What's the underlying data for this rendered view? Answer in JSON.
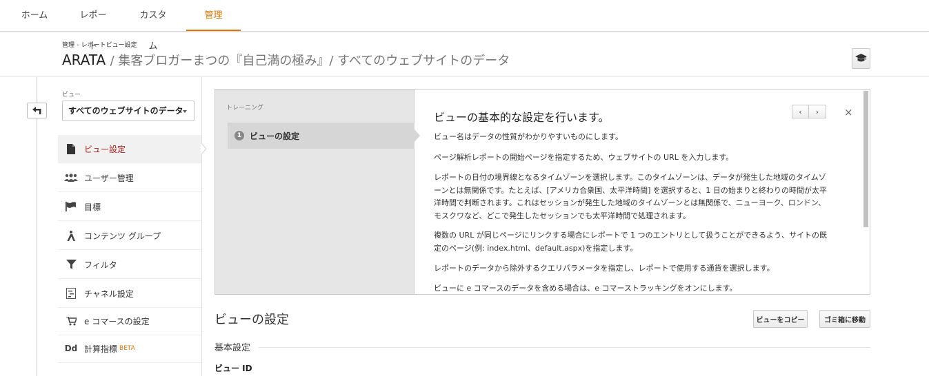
{
  "topnav": {
    "tabs": [
      {
        "label": "ホーム"
      },
      {
        "label": "レポート"
      },
      {
        "label": "カスタム"
      },
      {
        "label": "管理"
      }
    ],
    "active_color": "#e37400"
  },
  "header": {
    "breadcrumb": [
      "管理",
      "レポートビュー設定"
    ],
    "account": "ARATA",
    "title_rest": "/ 集客ブロガーまつの『自己満の極み』/ すべてのウェブサイトのデータ",
    "cap_icon": "graduation-cap-icon"
  },
  "sidebar": {
    "view_label": "ビュー",
    "view_selected": "すべてのウェブサイトのデータ",
    "items": [
      {
        "label": "ビュー設定",
        "icon": "document-icon",
        "active": true
      },
      {
        "label": "ユーザー管理",
        "icon": "users-icon"
      },
      {
        "label": "目標",
        "icon": "flag-icon"
      },
      {
        "label": "コンテンツ グループ",
        "icon": "person-walk-icon"
      },
      {
        "label": "フィルタ",
        "icon": "filter-icon"
      },
      {
        "label": "チャネル設定",
        "icon": "channel-settings-icon"
      },
      {
        "label": "e コマースの設定",
        "icon": "cart-icon"
      },
      {
        "label": "計算指標",
        "icon": "dd-icon",
        "badge": "BETA"
      }
    ],
    "active_color": "#b0201a"
  },
  "training": {
    "label": "トレーニング",
    "step_number": "1",
    "step_label": "ビューの設定",
    "title": "ビューの基本的な設定を行います。",
    "paragraphs": [
      "ビュー名はデータの性質がわかりやすいものにします。",
      "ページ解析レポートの開始ページを指定するため、ウェブサイトの URL を入力します。",
      "レポートの日付の境界線となるタイムゾーンを選択します。このタイムゾーンは、データが発生した地域のタイムゾーンとは無関係です。たとえば、[アメリカ合衆国、太平洋時間] を選択すると、1 日の始まりと終わりの時間が太平洋時間で判断されます。これはセッションが発生した地域のタイムゾーンとは無関係で、ニューヨーク、ロンドン、モスクワなど、どこで発生したセッションでも太平洋時間で処理されます。",
      "複数の URL が同じページにリンクする場合にレポートで 1 つのエントリとして扱うことができるよう、サイトの既定のページ(例: index.html、default.aspx)を指定します。",
      "レポートのデータから除外するクエリパラメータを指定し、レポートで使用する通貨を選択します。",
      "ビューに e コマースのデータを含める場合は、e コマーストラッキングをオンにします。"
    ],
    "prev": "‹",
    "next": "›",
    "close": "×"
  },
  "main": {
    "section_title": "ビューの設定",
    "copy_button": "ビューをコピー",
    "trash_button": "ゴミ箱に移動",
    "subsection": "基本設定",
    "field_view_id": "ビュー ID"
  }
}
